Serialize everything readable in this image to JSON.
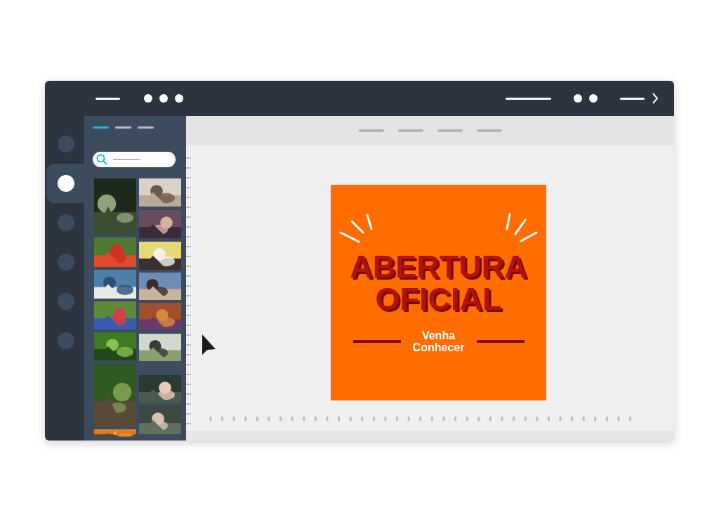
{
  "sidebar": {
    "items": [
      {
        "selected": false
      },
      {
        "selected": true
      },
      {
        "selected": false
      },
      {
        "selected": false
      },
      {
        "selected": false
      },
      {
        "selected": false
      }
    ]
  },
  "panel": {
    "tabs": [
      {
        "selected": true
      },
      {
        "selected": false
      },
      {
        "selected": false
      }
    ]
  },
  "design": {
    "headline": [
      "ABERTURA",
      "OFICIAL"
    ],
    "subtitle": "Venha Conhecer"
  }
}
